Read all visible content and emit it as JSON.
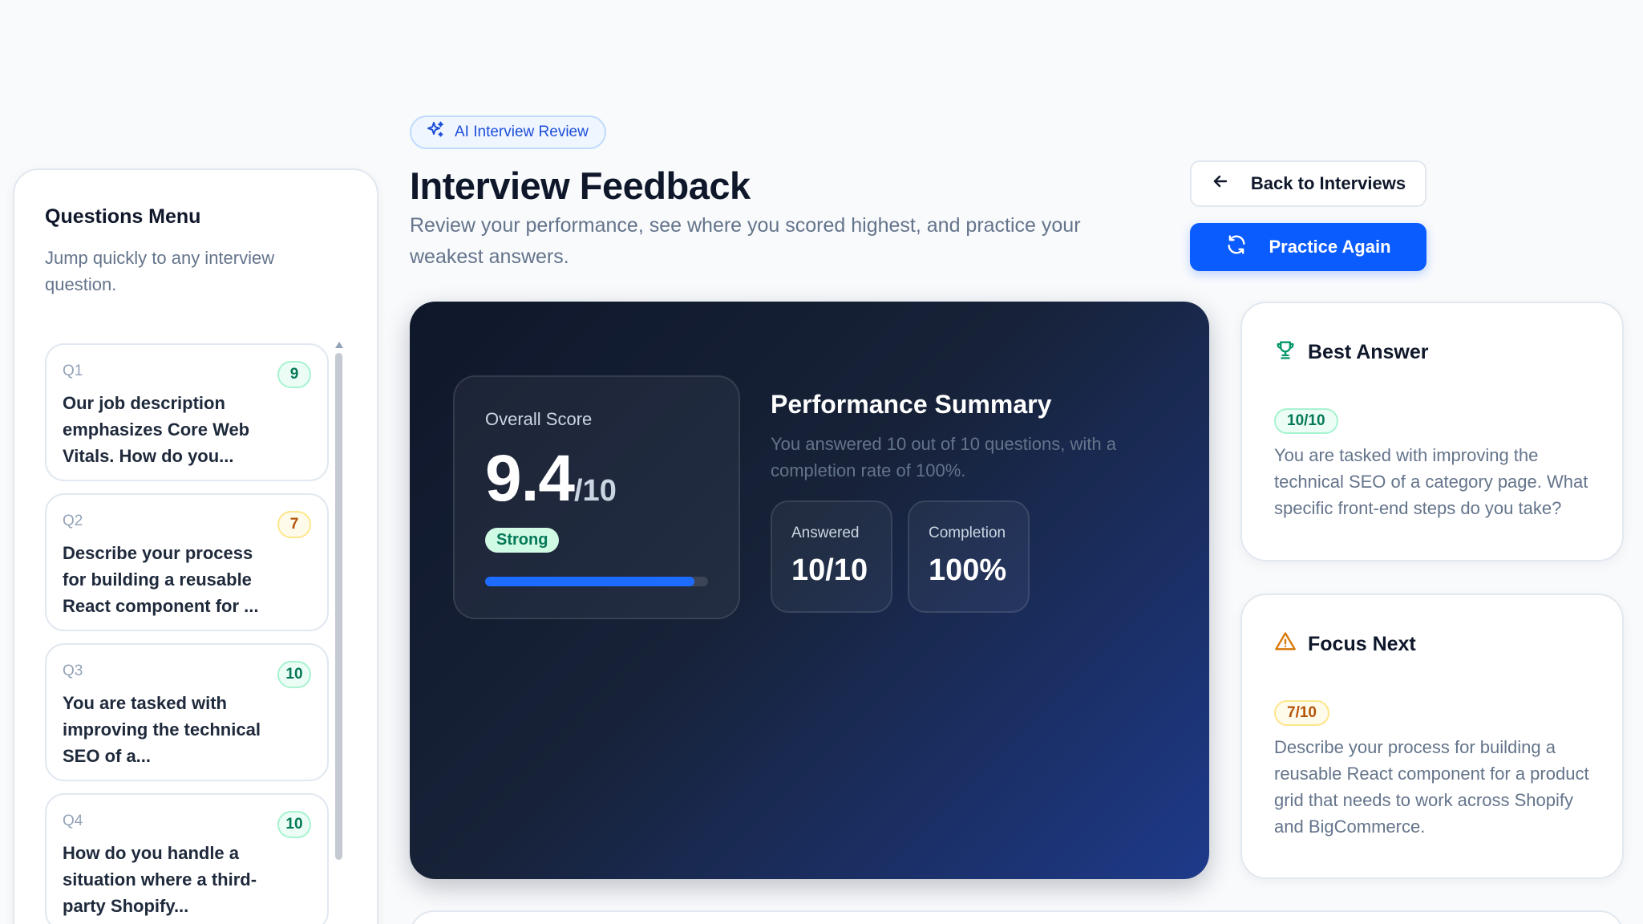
{
  "header": {
    "tag": "AI Interview Review",
    "title": "Interview Feedback",
    "subtitle": "Review your performance, see where you scored highest, and practice your weakest answers.",
    "back_label": "Back to Interviews",
    "practice_label": "Practice Again"
  },
  "sidebar": {
    "title": "Questions Menu",
    "subtitle": "Jump quickly to any interview question.",
    "questions": [
      {
        "num": "Q1",
        "text": "Our job description emphasizes Core Web Vitals. How do you...",
        "score": "9",
        "tone": "green"
      },
      {
        "num": "Q2",
        "text": "Describe your process for building a reusable React component for ...",
        "score": "7",
        "tone": "amber"
      },
      {
        "num": "Q3",
        "text": "You are tasked with improving the technical SEO of a...",
        "score": "10",
        "tone": "green"
      },
      {
        "num": "Q4",
        "text": "How do you handle a situation where a third-party Shopify...",
        "score": "10",
        "tone": "green"
      }
    ]
  },
  "summary": {
    "overall_label": "Overall Score",
    "score": "9.4",
    "score_of": "/10",
    "score_fraction": 0.94,
    "rating": "Strong",
    "perf_title": "Performance Summary",
    "perf_desc": "You answered 10 out of 10 questions, with a completion rate of 100%.",
    "answered_label": "Answered",
    "answered_value": "10/10",
    "completion_label": "Completion",
    "completion_value": "100%"
  },
  "best": {
    "title": "Best Answer",
    "score": "10/10",
    "text": "You are tasked with improving the technical SEO of a category page. What specific front-end steps do you take?"
  },
  "focus": {
    "title": "Focus Next",
    "score": "7/10",
    "text": "Describe your process for building a reusable React component for a product grid that needs to work across Shopify and BigCommerce."
  },
  "colors": {
    "accent": "#0b5cff",
    "success": "#047857",
    "warning": "#b45309"
  }
}
